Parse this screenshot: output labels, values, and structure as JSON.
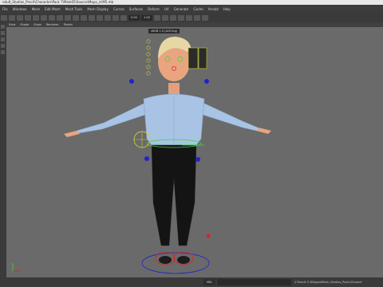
{
  "window": {
    "title": "ndult_Studios_Proch\\Character\\Pack 7\\Male05\\Source\\Maya_ic\\M5.mb"
  },
  "menubar": {
    "items": [
      "File",
      "Windows",
      "Mesh",
      "Edit Mesh",
      "Mesh Tools",
      "Mesh Display",
      "Curves",
      "Surfaces",
      "Deform",
      "UV",
      "Generate",
      "Cache",
      "Arnold",
      "Help"
    ]
  },
  "shelf": {
    "field_a": "0.00",
    "field_b": "1.00"
  },
  "panel": {
    "menus": [
      "View",
      "Shade",
      "Show",
      "Renderer",
      "Panels"
    ]
  },
  "hud": {
    "text": "sRGB 1.0 (ACEScg)"
  },
  "commandline": {
    "lang": "MEL",
    "result": "// Result: E:/ElegantMesh_Studios_Proch/Charact"
  },
  "colors": {
    "viewport_bg": "#6a6a6a",
    "controller_blue": "#2222cc",
    "controller_green": "#33dd33",
    "controller_yellow": "#cccc33",
    "controller_red": "#dd2222",
    "shirt": "#a9c3e4",
    "pants": "#141414",
    "hair": "#e7d7a4",
    "skin": "#e8a580"
  }
}
